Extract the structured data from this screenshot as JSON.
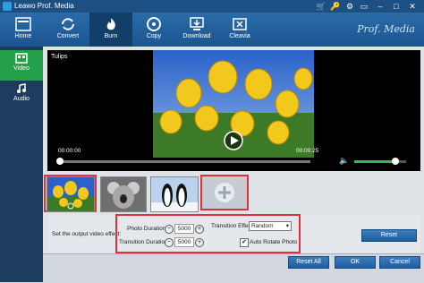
{
  "app": {
    "title": "Leawo Prof. Media",
    "brand": "Prof. Media"
  },
  "nav": [
    {
      "label": "Home"
    },
    {
      "label": "Convert"
    },
    {
      "label": "Burn"
    },
    {
      "label": "Copy"
    },
    {
      "label": "Download"
    },
    {
      "label": "Cleavia"
    }
  ],
  "sidebar": [
    {
      "label": "Video"
    },
    {
      "label": "Audio"
    }
  ],
  "player": {
    "title": "Tulips",
    "time_current": "00:00:00",
    "time_total": "00:00:25",
    "progress": 0.0,
    "volume": 0.8
  },
  "thumbnails": [
    {
      "name": "tulips",
      "selected": true
    },
    {
      "name": "koala",
      "selected": false
    },
    {
      "name": "penguins",
      "selected": false
    }
  ],
  "effect": {
    "section_label": "Set the output video effect:",
    "photo_duration_label": "Photo Duration:",
    "photo_duration_value": "5000",
    "transition_duration_label": "Transition Duration:",
    "transition_duration_value": "5000",
    "transition_effect_label": "Transition Effect:",
    "transition_effect_value": "Random",
    "auto_rotate_label": "Auto Rotate Photo",
    "auto_rotate_checked": true,
    "reset_label": "Reset"
  },
  "footer": {
    "reset_all_label": "Reset All",
    "ok_label": "OK",
    "cancel_label": "Cancel"
  },
  "colors": {
    "accent_green": "#25a04a",
    "highlight_red": "#e0313a",
    "nav_blue": "#1c5590"
  }
}
